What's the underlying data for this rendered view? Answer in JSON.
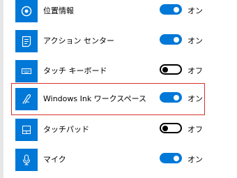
{
  "colors": {
    "accent": "#0078d7",
    "highlight_border": "#d9312b"
  },
  "settings": [
    {
      "icon": "location-icon",
      "label": "位置情報",
      "state": "オン",
      "on": true
    },
    {
      "icon": "action-center-icon",
      "label": "アクション センター",
      "state": "オン",
      "on": true
    },
    {
      "icon": "touch-keyboard-icon",
      "label": "タッチ キーボード",
      "state": "オフ",
      "on": false
    },
    {
      "icon": "windows-ink-icon",
      "label": "Windows Ink ワークスペース",
      "state": "オン",
      "on": true
    },
    {
      "icon": "touchpad-icon",
      "label": "タッチパッド",
      "state": "オフ",
      "on": false
    },
    {
      "icon": "microphone-icon",
      "label": "マイク",
      "state": "オン",
      "on": true
    }
  ]
}
